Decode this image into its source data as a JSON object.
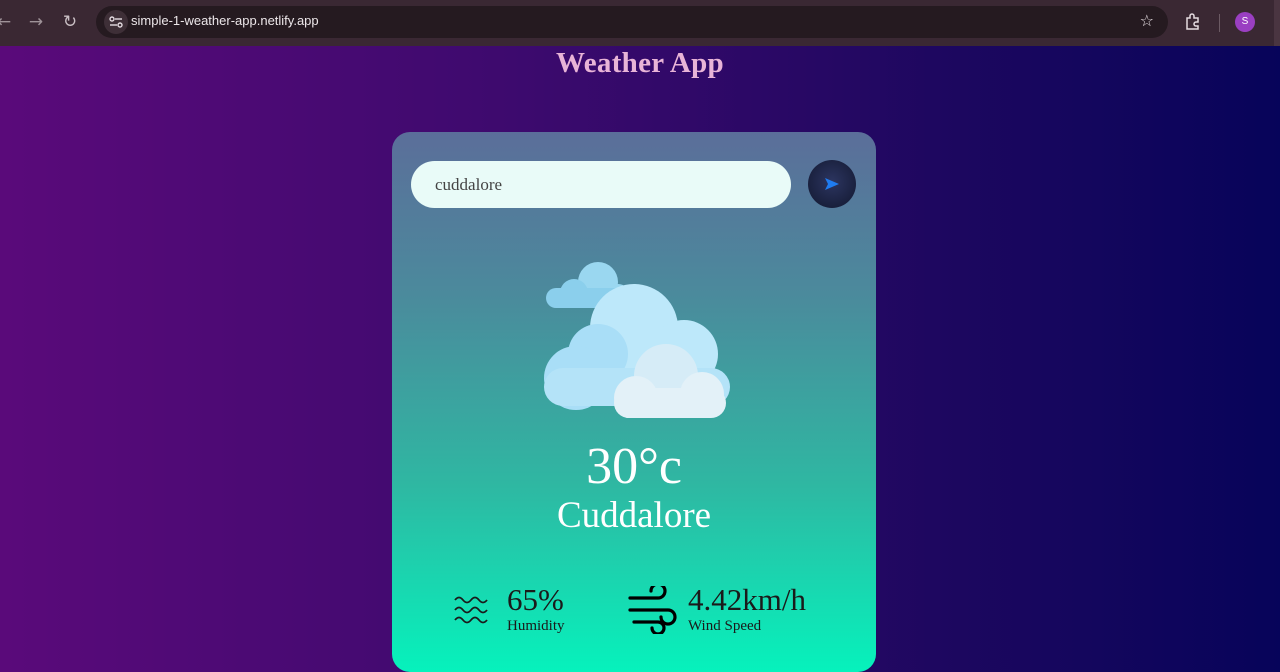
{
  "browser": {
    "url": "simple-1-weather-app.netlify.app",
    "profile_initial": "S",
    "icons": [
      "back-arrow-icon",
      "forward-arrow-icon",
      "reload-icon",
      "site-info-icon",
      "bookmark-star-icon",
      "extensions-icon"
    ]
  },
  "page": {
    "title": "Weather App"
  },
  "search": {
    "value": "cuddalore",
    "button_icon": "send-arrow-icon"
  },
  "weather": {
    "icon": "cloudy-icon",
    "temperature": "30°c",
    "city": "Cuddalore",
    "humidity": {
      "value": "65%",
      "label": "Humidity",
      "icon": "humidity-waves-icon"
    },
    "wind": {
      "value": "4.42km/h",
      "label": "Wind Speed",
      "icon": "wind-icon"
    }
  },
  "colors": {
    "title": "#e8b4d7",
    "card_top": "#5b6e9a",
    "card_bottom": "#06f2bc",
    "send_arrow": "#1f7cf0"
  }
}
